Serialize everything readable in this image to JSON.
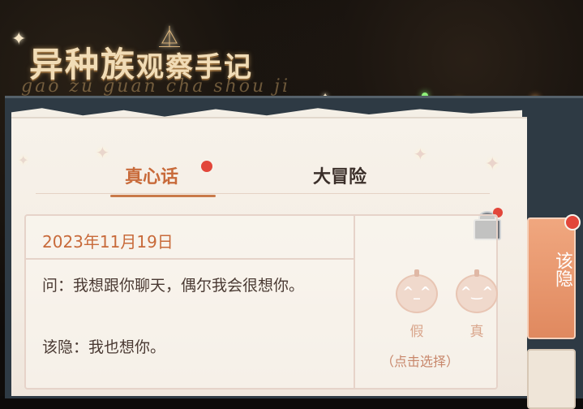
{
  "header": {
    "title_main": "异种族",
    "title_small": "观察手记",
    "title_script": "gao zu guan cha shou ji"
  },
  "tabs": [
    {
      "label": "真心话",
      "active": true
    },
    {
      "label": "大冒险",
      "active": false
    }
  ],
  "card": {
    "date": "2023年11月19日",
    "question": "问：我想跟你聊天，偶尔我会很想你。",
    "answer": "该隐：我也想你。"
  },
  "choices": {
    "fake_label": "假",
    "true_label": "真",
    "hint": "（点击选择）"
  },
  "side_tab": {
    "label": "该隐"
  },
  "colors": {
    "accent": "#c86a3a",
    "notification": "#e2463a",
    "side_tab": "#e0895f"
  },
  "icons": {
    "gift": "gift-icon",
    "pumpkin": "pumpkin-icon"
  }
}
